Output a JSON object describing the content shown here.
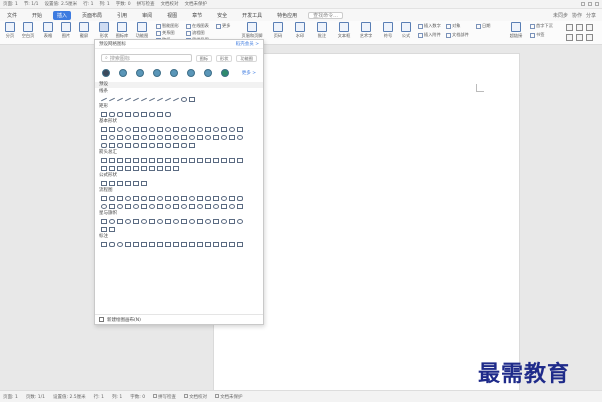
{
  "titlebar": {
    "items": [
      "页面: 1",
      "节: 1/1",
      "设置值: 2.5厘米",
      "行: 1",
      "列: 1",
      "字数: 0",
      "拼写检查",
      "文档校对",
      "文档未保护"
    ]
  },
  "menubar": {
    "file_label": "文件",
    "tabs": [
      "开始",
      "插入",
      "页面布局",
      "引用",
      "审阅",
      "视图",
      "章节",
      "安全",
      "开发工具",
      "特色应用"
    ],
    "active_tab": "插入",
    "search_placeholder": "查找命令...",
    "right_items": [
      "未同步",
      "协作",
      "分享"
    ]
  },
  "ribbon": {
    "big": [
      "分页",
      "空白页",
      "表格",
      "图片",
      "截屏",
      "形状",
      "图标库",
      "功能图",
      "稿纸",
      "页眉和页脚",
      "页码",
      "水印",
      "批注",
      "文本框",
      "艺术字",
      "符号",
      "公式"
    ],
    "small": [
      "智能图形",
      "关系图",
      "在线图表",
      "流程图",
      "思维导图",
      "更多",
      "插入数字",
      "对象",
      "插入附件",
      "文档部件",
      "日期",
      "首字下沉",
      "超链接",
      "书签",
      "交叉引用"
    ]
  },
  "panel": {
    "title": "预设网格图标",
    "more_link": "稻壳会员 >",
    "search_placeholder": "搜索图标",
    "chips": [
      "图标",
      "形状",
      "功能图"
    ],
    "icons_more": "更多 >",
    "section_head": "预设",
    "sections": [
      "线条",
      "矩形",
      "基本形状",
      "箭头总汇",
      "公式形状",
      "流程图",
      "星与旗帜",
      "标注"
    ],
    "footer": "新建绘图画布(N)"
  },
  "statusbar": {
    "items": [
      "页面: 1",
      "页数: 1/1",
      "设置值: 2.5厘米",
      "行: 1",
      "列: 1",
      "字数: 0",
      "拼写检查",
      "文档校对",
      "文档未保护"
    ]
  },
  "watermark": "最需教育",
  "colors": {
    "accent": "#3d7be0",
    "watermark": "#1f2b8a"
  }
}
